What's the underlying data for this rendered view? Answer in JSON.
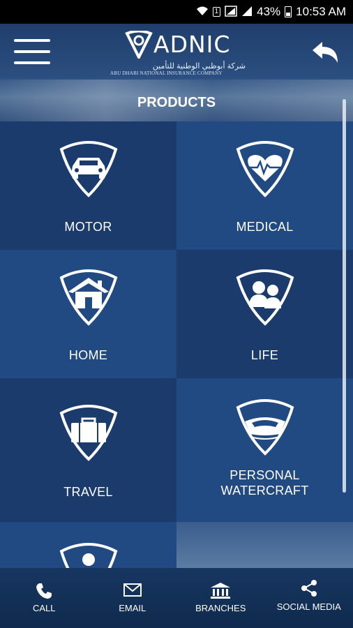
{
  "status_bar": {
    "battery": "43%",
    "time": "10:53 AM",
    "sim_badge": "1"
  },
  "header": {
    "logo_name": "ADNIC",
    "logo_arabic": "شركة أبوظبي الوطنية للتأمين",
    "logo_subtitle": "ABU DHABI NATIONAL INSURANCE COMPANY",
    "page_title": "PRODUCTS"
  },
  "products": [
    {
      "label": "MOTOR",
      "icon": "car-icon"
    },
    {
      "label": "MEDICAL",
      "icon": "heart-pulse-icon"
    },
    {
      "label": "HOME",
      "icon": "house-icon"
    },
    {
      "label": "LIFE",
      "icon": "people-icon"
    },
    {
      "label": "TRAVEL",
      "icon": "suitcase-icon"
    },
    {
      "label": "PERSONAL WATERCRAFT",
      "icon": "boat-icon"
    }
  ],
  "bottom_nav": [
    {
      "label": "CALL",
      "icon": "phone-icon"
    },
    {
      "label": "EMAIL",
      "icon": "envelope-icon"
    },
    {
      "label": "BRANCHES",
      "icon": "bank-icon"
    },
    {
      "label": "SOCIAL MEDIA",
      "icon": "share-icon"
    }
  ],
  "colors": {
    "tile_dark": "#1a3b6c",
    "tile_light": "#224a82",
    "text": "#ffffff"
  }
}
